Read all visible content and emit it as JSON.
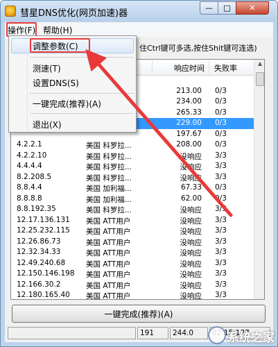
{
  "window": {
    "title": "彗星DNS优化(网页加速)器",
    "min_glyph": "—",
    "max_glyph": "□",
    "close_glyph": "✕"
  },
  "menubar": {
    "operate": "操作(F)",
    "help": "帮助(H)"
  },
  "dropdown": {
    "items": [
      "调整参数(C)",
      "测速(T)",
      "设置DNS(S)",
      "一键完成(推荐)(A)",
      "退出(X)"
    ]
  },
  "hint_text": "住Ctrl键可多选,按住Shit键可连选)",
  "table": {
    "headers": [
      "",
      "",
      "响应时间",
      "失败率"
    ],
    "rows": [
      {
        "ip": "",
        "loc": "",
        "resp": "",
        "loss": ""
      },
      {
        "ip": "",
        "loc": "",
        "resp": "213.00",
        "loss": "0/3"
      },
      {
        "ip": "",
        "loc": "",
        "resp": "234.00",
        "loss": "0/3"
      },
      {
        "ip": "",
        "loc": "",
        "resp": "265.33",
        "loss": "0/3"
      },
      {
        "ip": "",
        "loc": "",
        "resp": "229.00",
        "loss": "0/3"
      },
      {
        "ip": "",
        "loc": "",
        "resp": "197.67",
        "loss": "0/3"
      },
      {
        "ip": "4.2.2.1",
        "loc": "美国 科罗拉...",
        "resp": "208.00",
        "loss": "0/3"
      },
      {
        "ip": "4.2.2.10",
        "loc": "美国 科罗拉...",
        "resp": "没响应",
        "loss": "3/3"
      },
      {
        "ip": "4.4.4.4",
        "loc": "美国 科罗拉...",
        "resp": "没响应",
        "loss": "3/3"
      },
      {
        "ip": "8.2.208.5",
        "loc": "美国 科罗拉...",
        "resp": "没响应",
        "loss": "3/3"
      },
      {
        "ip": "8.8.4.4",
        "loc": "美国 加利福...",
        "resp": "67.33",
        "loss": "0/3"
      },
      {
        "ip": "8.8.8.8",
        "loc": "美国 加利福...",
        "resp": "62.00",
        "loss": "0/3"
      },
      {
        "ip": "8.8.192.35",
        "loc": "美国 科罗拉...",
        "resp": "没响应",
        "loss": "3/3"
      },
      {
        "ip": "12.17.136.131",
        "loc": "美国 ATT用户",
        "resp": "没响应",
        "loss": "3/3"
      },
      {
        "ip": "12.25.232.115",
        "loc": "美国 ATT用户",
        "resp": "没响应",
        "loss": "3/3"
      },
      {
        "ip": "12.26.86.73",
        "loc": "美国 ATT用户",
        "resp": "没响应",
        "loss": "3/3"
      },
      {
        "ip": "12.32.34.33",
        "loc": "美国 ATT用户",
        "resp": "没响应",
        "loss": "3/3"
      },
      {
        "ip": "12.49.240.68",
        "loc": "美国 ATT用户",
        "resp": "没响应",
        "loss": "3/3"
      },
      {
        "ip": "12.150.146.198",
        "loc": "美国 ATT用户",
        "resp": "没响应",
        "loss": "3/3"
      },
      {
        "ip": "12.166.30.2",
        "loc": "美国 ATT用户",
        "resp": "没响应",
        "loss": "3/3"
      },
      {
        "ip": "12.180.165.40",
        "loc": "美国 ATT用户",
        "resp": "没响应",
        "loss": "3/3"
      }
    ]
  },
  "big_button": "一键完成(推荐)(A)",
  "status": {
    "panel1": "191",
    "panel2": "244.0",
    "panel3": "02:15:137"
  },
  "watermark": {
    "text": "系统之家"
  },
  "colors": {
    "highlight_red": "#e83a3a",
    "selection_blue": "#3399ff"
  }
}
